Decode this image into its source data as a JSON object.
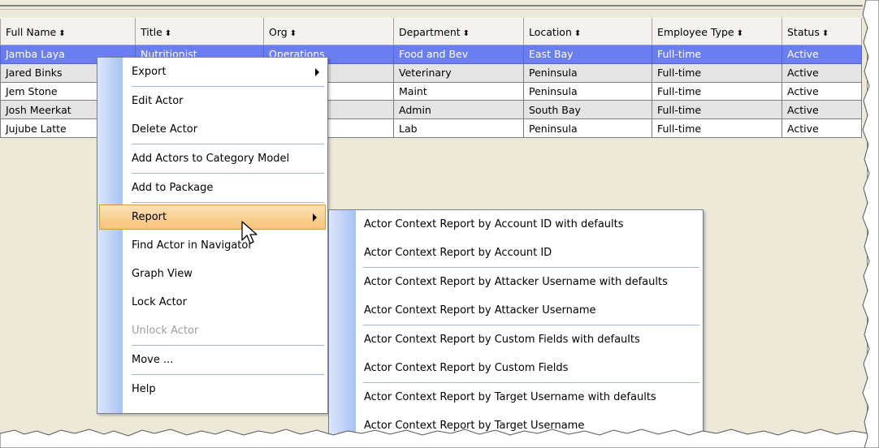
{
  "table": {
    "columns": [
      {
        "label": "Full Name",
        "sort_icon": "sort-icon"
      },
      {
        "label": "Title",
        "sort_icon": "sort-icon"
      },
      {
        "label": "Org",
        "sort_icon": "sort-icon"
      },
      {
        "label": "Department",
        "sort_icon": "sort-icon"
      },
      {
        "label": "Location",
        "sort_icon": "sort-icon"
      },
      {
        "label": "Employee Type",
        "sort_icon": "sort-icon"
      },
      {
        "label": "Status",
        "sort_icon": "sort-icon"
      }
    ],
    "sort_glyph": "⬍",
    "rows": [
      {
        "name": "Jamba Laya",
        "title": "Nutritionist",
        "org": "Operations",
        "department": "Food and Bev",
        "location": "East Bay",
        "type": "Full-time",
        "status": "Active"
      },
      {
        "name": "Jared Binks",
        "title": "",
        "org": "",
        "department": "Veterinary",
        "location": "Peninsula",
        "type": "Full-time",
        "status": "Active"
      },
      {
        "name": "Jem Stone",
        "title": "",
        "org": "",
        "department": "Maint",
        "location": "Peninsula",
        "type": "Full-time",
        "status": "Active"
      },
      {
        "name": "Josh Meerkat",
        "title": "",
        "org": "",
        "department": "Admin",
        "location": "South Bay",
        "type": "Full-time",
        "status": "Active"
      },
      {
        "name": "Jujube Latte",
        "title": "",
        "org": "",
        "department": "Lab",
        "location": "Peninsula",
        "type": "Full-time",
        "status": "Active"
      }
    ]
  },
  "context_menu": {
    "export": "Export",
    "edit_actor": "Edit Actor",
    "delete_actor": "Delete Actor",
    "add_to_category": "Add Actors to Category Model",
    "add_to_package": "Add to Package",
    "report": "Report",
    "find_in_navigator": "Find Actor in Navigator",
    "graph_view": "Graph View",
    "lock_actor": "Lock Actor",
    "unlock_actor": "Unlock Actor",
    "move": "Move ...",
    "help": "Help"
  },
  "report_submenu": {
    "items": [
      "Actor Context Report by Account ID with defaults",
      "Actor Context Report by Account ID",
      "Actor Context Report by Attacker Username with defaults",
      "Actor Context Report by Attacker Username",
      "Actor Context Report by Custom Fields with defaults",
      "Actor Context Report by Custom Fields",
      "Actor Context Report by Target Username with defaults",
      "Actor Context Report by Target Username"
    ]
  },
  "colors": {
    "selection": "#6b7ef0",
    "menu_highlight": "#f7c27a",
    "menu_gutter": "#a9c2f3",
    "window_bg": "#ece9d8"
  }
}
